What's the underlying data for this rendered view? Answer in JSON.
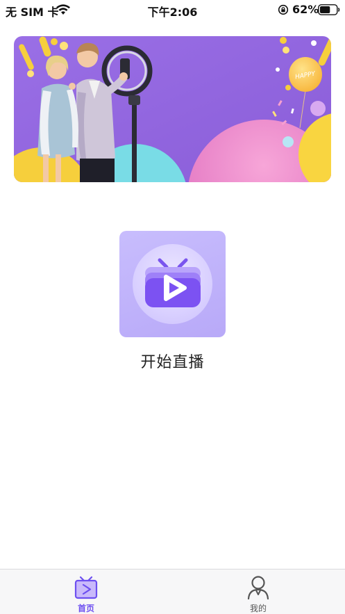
{
  "status_bar": {
    "carrier": "无 SIM 卡",
    "time": "下午2:06",
    "battery_percent": "62%",
    "battery_level": 0.62
  },
  "banner": {
    "balloon_text": "HAPPY"
  },
  "main": {
    "start_live_label": "开始直播"
  },
  "tab_bar": {
    "tabs": [
      {
        "label": "首页",
        "icon": "tv-play-icon",
        "active": true
      },
      {
        "label": "我的",
        "icon": "user-icon",
        "active": false
      }
    ]
  },
  "colors": {
    "accent": "#6d4ff0",
    "tile": "#c3b6fb",
    "banner_bg": "#9b6be0"
  }
}
